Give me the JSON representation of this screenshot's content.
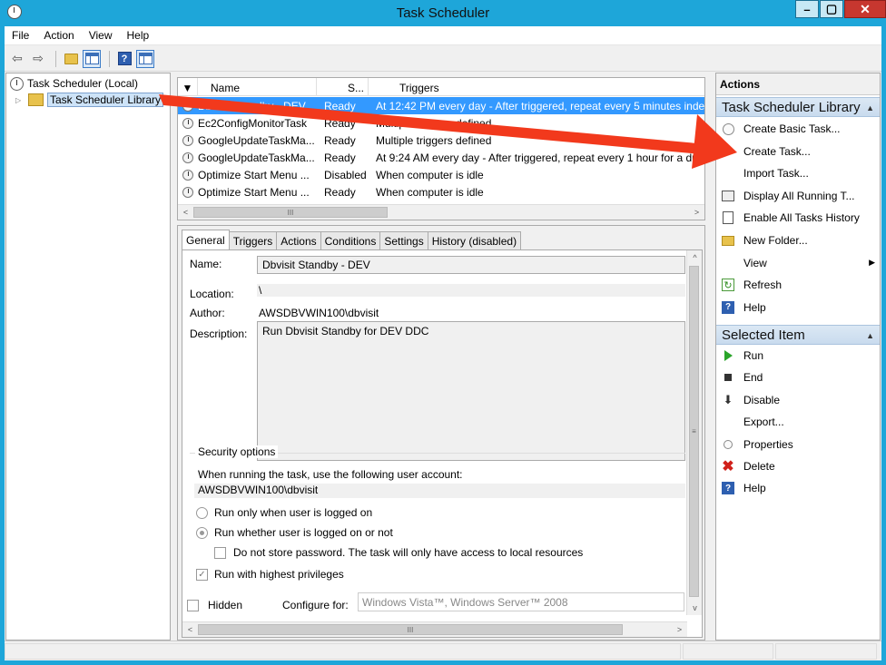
{
  "window": {
    "title": "Task Scheduler",
    "controls": {
      "minimize": "–",
      "maximize": "▢",
      "close": "✕"
    }
  },
  "menubar": {
    "items": [
      "File",
      "Action",
      "View",
      "Help"
    ]
  },
  "toolbar": {
    "buttons": [
      "back-icon",
      "forward-icon",
      "up-folder-icon",
      "show-hide-console-tree-icon",
      "help-icon",
      "show-hide-action-pane-icon"
    ]
  },
  "tree": {
    "root": "Task Scheduler (Local)",
    "library": "Task Scheduler Library"
  },
  "tasklist": {
    "columns": {
      "name": "Name",
      "status": "S...",
      "triggers": "Triggers"
    },
    "rows": [
      {
        "name": "Dbvisit Standby - DEV",
        "status": "Ready",
        "triggers": "At 12:42 PM every day - After triggered, repeat every 5 minutes indefin",
        "selected": true
      },
      {
        "name": "Ec2ConfigMonitorTask",
        "status": "Ready",
        "triggers": "Multiple triggers defined"
      },
      {
        "name": "GoogleUpdateTaskMa...",
        "status": "Ready",
        "triggers": "Multiple triggers defined"
      },
      {
        "name": "GoogleUpdateTaskMa...",
        "status": "Ready",
        "triggers": "At 9:24 AM every day - After triggered, repeat every 1 hour for a du"
      },
      {
        "name": "Optimize Start Menu ...",
        "status": "Disabled",
        "triggers": "When computer is idle"
      },
      {
        "name": "Optimize Start Menu ...",
        "status": "Ready",
        "triggers": "When computer is idle"
      }
    ],
    "scroll_glyph": "III"
  },
  "detail": {
    "tabs": [
      "General",
      "Triggers",
      "Actions",
      "Conditions",
      "Settings",
      "History (disabled)"
    ],
    "active_tab": "General",
    "labels": {
      "name": "Name:",
      "location": "Location:",
      "author": "Author:",
      "description": "Description:"
    },
    "values": {
      "name": "Dbvisit Standby - DEV",
      "location": "\\",
      "author": "AWSDBVWIN100\\dbvisit",
      "description": "Run Dbvisit Standby for DEV DDC"
    },
    "security": {
      "legend": "Security options",
      "account_prompt": "When running the task, use the following user account:",
      "account": "AWSDBVWIN100\\dbvisit",
      "opt_logged_on": "Run only when user is logged on",
      "opt_whether": "Run whether user is logged on or not",
      "opt_no_store": "Do not store password.  The task will only have access to local resources",
      "opt_highest": "Run with highest privileges",
      "selected_radio": "opt_whether",
      "highest_checked": true,
      "no_store_checked": false
    },
    "hidden_label": "Hidden",
    "hidden_checked": false,
    "configure_label": "Configure for:",
    "configure_value": "Windows Vista™, Windows Server™ 2008",
    "scroll_glyph": "III"
  },
  "actions": {
    "header": "Actions",
    "section_library": "Task Scheduler Library",
    "library_items": [
      {
        "label": "Create Basic Task...",
        "icon": "create-basic-task-icon"
      },
      {
        "label": "Create Task...",
        "icon": "create-task-icon"
      },
      {
        "label": "Import Task...",
        "icon": ""
      },
      {
        "label": "Display All Running T...",
        "icon": "display-running-icon"
      },
      {
        "label": "Enable All Tasks History",
        "icon": "enable-history-icon"
      },
      {
        "label": "New Folder...",
        "icon": "new-folder-icon"
      },
      {
        "label": "View",
        "icon": "",
        "submenu": true
      },
      {
        "label": "Refresh",
        "icon": "refresh-icon"
      },
      {
        "label": "Help",
        "icon": "help-icon"
      }
    ],
    "section_selected": "Selected Item",
    "selected_items": [
      {
        "label": "Run",
        "icon": "run-icon"
      },
      {
        "label": "End",
        "icon": "end-icon"
      },
      {
        "label": "Disable",
        "icon": "disable-icon"
      },
      {
        "label": "Export...",
        "icon": ""
      },
      {
        "label": "Properties",
        "icon": "properties-icon"
      },
      {
        "label": "Delete",
        "icon": "delete-icon"
      },
      {
        "label": "Help",
        "icon": "help-icon"
      }
    ]
  },
  "annotation": {
    "arrow_color": "#f2391c"
  }
}
